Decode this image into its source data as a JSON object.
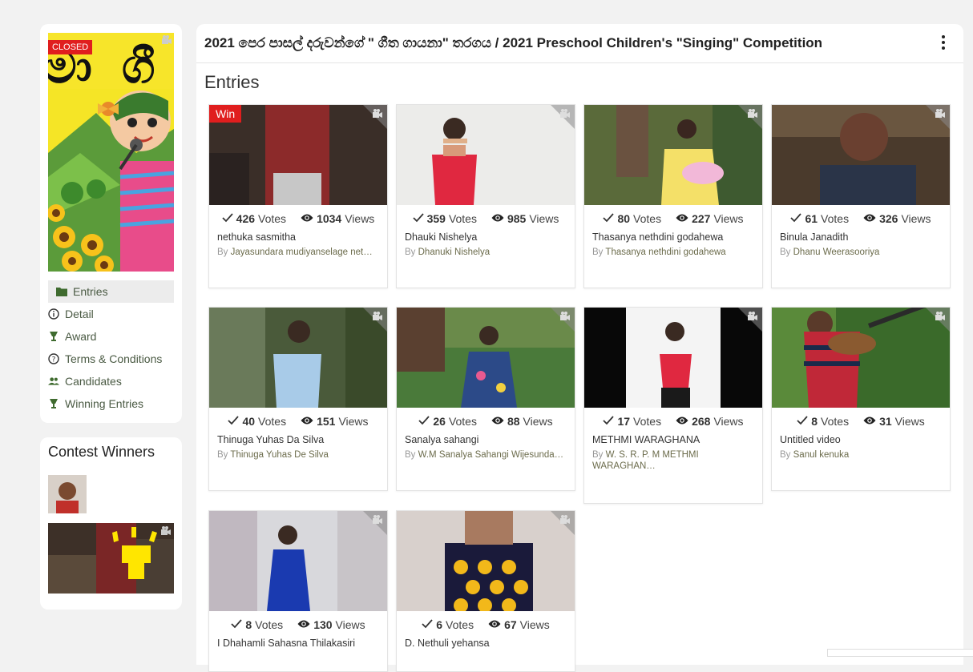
{
  "sidebar": {
    "closed_label": "CLOSED",
    "menu": [
      {
        "label": "Entries",
        "icon": "folder-icon"
      },
      {
        "label": "Detail",
        "icon": "info-icon"
      },
      {
        "label": "Award",
        "icon": "trophy-icon"
      },
      {
        "label": "Terms & Conditions",
        "icon": "help-icon"
      },
      {
        "label": "Candidates",
        "icon": "people-icon"
      },
      {
        "label": "Winning Entries",
        "icon": "trophy-icon"
      }
    ],
    "winners_title": "Contest Winners"
  },
  "main": {
    "title": "2021 පෙර පාසල් දරුවන්ගේ \" ගීත ගායනා\" තරගය / 2021 Preschool Children's \"Singing\" Competition",
    "section_heading": "Entries",
    "votes_label": "Votes",
    "views_label": "Views",
    "by_label": "By",
    "win_label": "Win",
    "entries": [
      {
        "votes": "426",
        "views": "1034",
        "title": "nethuka sasmitha",
        "author": "Jayasundara mudiyanselage net…",
        "win": true
      },
      {
        "votes": "359",
        "views": "985",
        "title": "Dhauki Nishelya",
        "author": "Dhanuki Nishelya"
      },
      {
        "votes": "80",
        "views": "227",
        "title": "Thasanya nethdini godahewa",
        "author": "Thasanya nethdini godahewa"
      },
      {
        "votes": "61",
        "views": "326",
        "title": "Binula Janadith",
        "author": "Dhanu Weerasooriya"
      },
      {
        "votes": "40",
        "views": "151",
        "title": "Thinuga Yuhas Da Silva",
        "author": "Thinuga Yuhas De Silva"
      },
      {
        "votes": "26",
        "views": "88",
        "title": "Sanalya sahangi",
        "author": "W.M Sanalya Sahangi Wijesunda…"
      },
      {
        "votes": "17",
        "views": "268",
        "title": "METHMI WARAGHANA",
        "author": "W. S. R. P. M METHMI WARAGHAN…"
      },
      {
        "votes": "8",
        "views": "31",
        "title": "Untitled video",
        "author": "Sanul kenuka"
      },
      {
        "votes": "8",
        "views": "130",
        "title": "I Dhahamli Sahasna Thilakasiri",
        "author": ""
      },
      {
        "votes": "6",
        "views": "67",
        "title": "D. Nethuli yehansa",
        "author": ""
      }
    ]
  },
  "colors": {
    "accent_green": "#4a7a3a",
    "win_red": "#e01e1e"
  }
}
